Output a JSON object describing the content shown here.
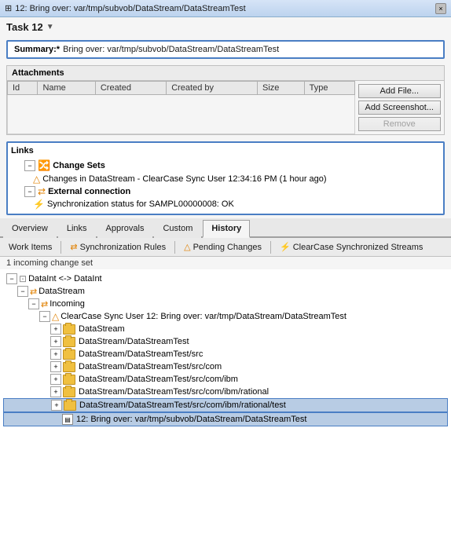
{
  "titlebar": {
    "title": "12: Bring over: var/tmp/subvob/DataStream/DataStreamTest",
    "close_label": "×"
  },
  "task": {
    "label": "Task 12",
    "dropdown_label": "▼"
  },
  "summary": {
    "label": "Summary:*",
    "value": "Bring over: var/tmp/subvob/DataStream/DataStreamTest"
  },
  "attachments": {
    "header": "Attachments",
    "columns": [
      "Id",
      "Name",
      "Created",
      "Created by",
      "Size",
      "Type"
    ],
    "rows": [],
    "buttons": {
      "add_file": "Add File...",
      "add_screenshot": "Add Screenshot...",
      "remove": "Remove"
    }
  },
  "links": {
    "header": "Links",
    "items": [
      {
        "indent": 0,
        "icon": "tree-expand",
        "bold": true,
        "label": "Change Sets"
      },
      {
        "indent": 1,
        "icon": "changeset",
        "label": "Changes in DataStream - ClearCase Sync User 12:34:16 PM (1 hour ago)"
      },
      {
        "indent": 0,
        "icon": "tree-expand",
        "bold": true,
        "label": "External connection"
      },
      {
        "indent": 1,
        "icon": "sync",
        "label": "Synchronization status for SAMPL00000008: OK"
      }
    ]
  },
  "tabs": {
    "items": [
      "Overview",
      "Links",
      "Approvals",
      "Custom",
      "History"
    ],
    "active": "History"
  },
  "toolbar": {
    "work_items": "Work Items",
    "sync_rules": "Synchronization Rules",
    "pending_changes": "Pending Changes",
    "clearcase_streams": "ClearCase Synchronized Streams"
  },
  "tree": {
    "status": "1 incoming change set",
    "nodes": [
      {
        "indent": 0,
        "type": "expand",
        "icon": "root",
        "label": "DataInt <-> DataInt"
      },
      {
        "indent": 1,
        "type": "expand",
        "icon": "sync-folder",
        "label": "DataStream"
      },
      {
        "indent": 2,
        "type": "expand",
        "icon": "sync-folder",
        "label": "Incoming"
      },
      {
        "indent": 3,
        "type": "expand",
        "icon": "sync-user",
        "label": "ClearCase Sync User  12: Bring over: var/tmp/DataStream/DataStreamTest"
      },
      {
        "indent": 4,
        "type": "expand",
        "icon": "folder",
        "label": "DataStream"
      },
      {
        "indent": 4,
        "type": "expand",
        "icon": "folder",
        "label": "DataStream/DataStreamTest"
      },
      {
        "indent": 4,
        "type": "expand",
        "icon": "folder",
        "label": "DataStream/DataStreamTest/src"
      },
      {
        "indent": 4,
        "type": "expand",
        "icon": "folder",
        "label": "DataStream/DataStreamTest/src/com"
      },
      {
        "indent": 4,
        "type": "expand",
        "icon": "folder",
        "label": "DataStream/DataStreamTest/src/com/ibm"
      },
      {
        "indent": 4,
        "type": "expand",
        "icon": "folder",
        "label": "DataStream/DataStreamTest/src/com/ibm/rational"
      },
      {
        "indent": 4,
        "type": "expand-highlighted",
        "icon": "folder",
        "label": "DataStream/DataStreamTest/src/com/ibm/rational/test"
      },
      {
        "indent": 5,
        "type": "file-highlighted",
        "icon": "file",
        "label": "12: Bring over: var/tmp/subvob/DataStream/DataStreamTest"
      }
    ]
  }
}
